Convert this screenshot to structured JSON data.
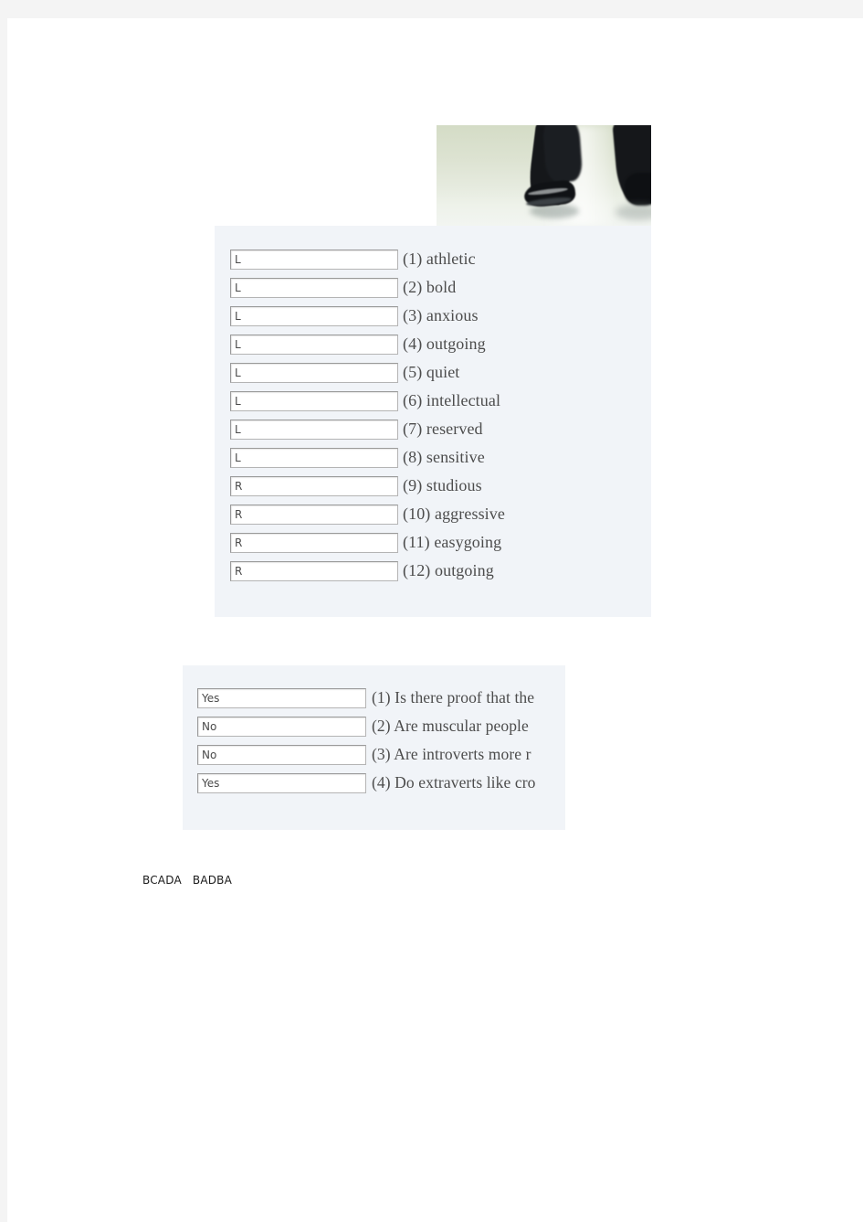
{
  "document": {
    "photo": {
      "alt": "person-legs-standing-on-pale-floor"
    },
    "traits_panel": {
      "rows": [
        {
          "value": "L",
          "label": "(1) athletic"
        },
        {
          "value": "L",
          "label": "(2) bold"
        },
        {
          "value": "L",
          "label": "(3) anxious"
        },
        {
          "value": "L",
          "label": "(4) outgoing"
        },
        {
          "value": "L",
          "label": "(5) quiet"
        },
        {
          "value": "L",
          "label": "(6) intellectual"
        },
        {
          "value": "L",
          "label": "(7) reserved"
        },
        {
          "value": "L",
          "label": "(8) sensitive"
        },
        {
          "value": "R",
          "label": "(9) studious"
        },
        {
          "value": "R",
          "label": "(10) aggressive"
        },
        {
          "value": "R",
          "label": "(11) easygoing"
        },
        {
          "value": "R",
          "label": "(12) outgoing"
        }
      ]
    },
    "questions_panel": {
      "rows": [
        {
          "value": "Yes",
          "label": "(1) Is there proof that the"
        },
        {
          "value": "No",
          "label": "(2) Are muscular people"
        },
        {
          "value": "No",
          "label": "(3) Are introverts more r"
        },
        {
          "value": "Yes",
          "label": "(4) Do extraverts like cro"
        }
      ]
    },
    "answer_key": "BCADA   BADBA"
  }
}
